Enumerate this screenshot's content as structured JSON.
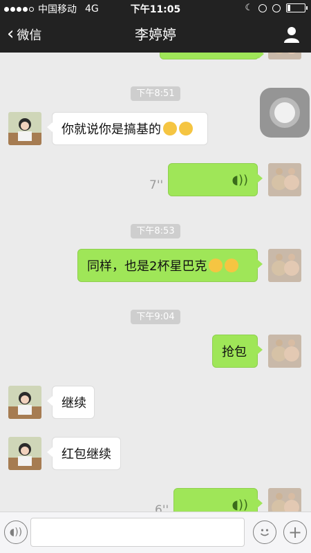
{
  "status_bar": {
    "carrier": "中国移动",
    "network": "4G",
    "time": "下午11:05"
  },
  "nav": {
    "back_label": "微信",
    "title": "李婷婷"
  },
  "messages": [
    {
      "type": "timestamp",
      "text": "下午8:51"
    },
    {
      "type": "text",
      "side": "left",
      "text": "你就说你是搞基的",
      "emoji": [
        "grin-emoji",
        "grin-emoji"
      ]
    },
    {
      "type": "voice",
      "side": "right",
      "duration": "7''"
    },
    {
      "type": "timestamp",
      "text": "下午8:53"
    },
    {
      "type": "text",
      "side": "right",
      "text": "同样，也是2杯星巴克",
      "emoji": [
        "kiss-emoji",
        "kiss-emoji"
      ]
    },
    {
      "type": "timestamp",
      "text": "下午9:04"
    },
    {
      "type": "text",
      "side": "right",
      "text": "抢包"
    },
    {
      "type": "text",
      "side": "left",
      "text": "继续"
    },
    {
      "type": "text",
      "side": "left",
      "text": "红包继续"
    },
    {
      "type": "voice",
      "side": "right",
      "duration": "6''"
    }
  ],
  "input_bar": {
    "voice_icon": "voice-icon",
    "emoji_icon": "smiley-icon",
    "plus_icon": "plus-icon",
    "placeholder": ""
  },
  "colors": {
    "nav_bg": "#222222",
    "chat_bg": "#ebebeb",
    "bubble_green": "#9fe658",
    "bubble_white": "#ffffff"
  }
}
